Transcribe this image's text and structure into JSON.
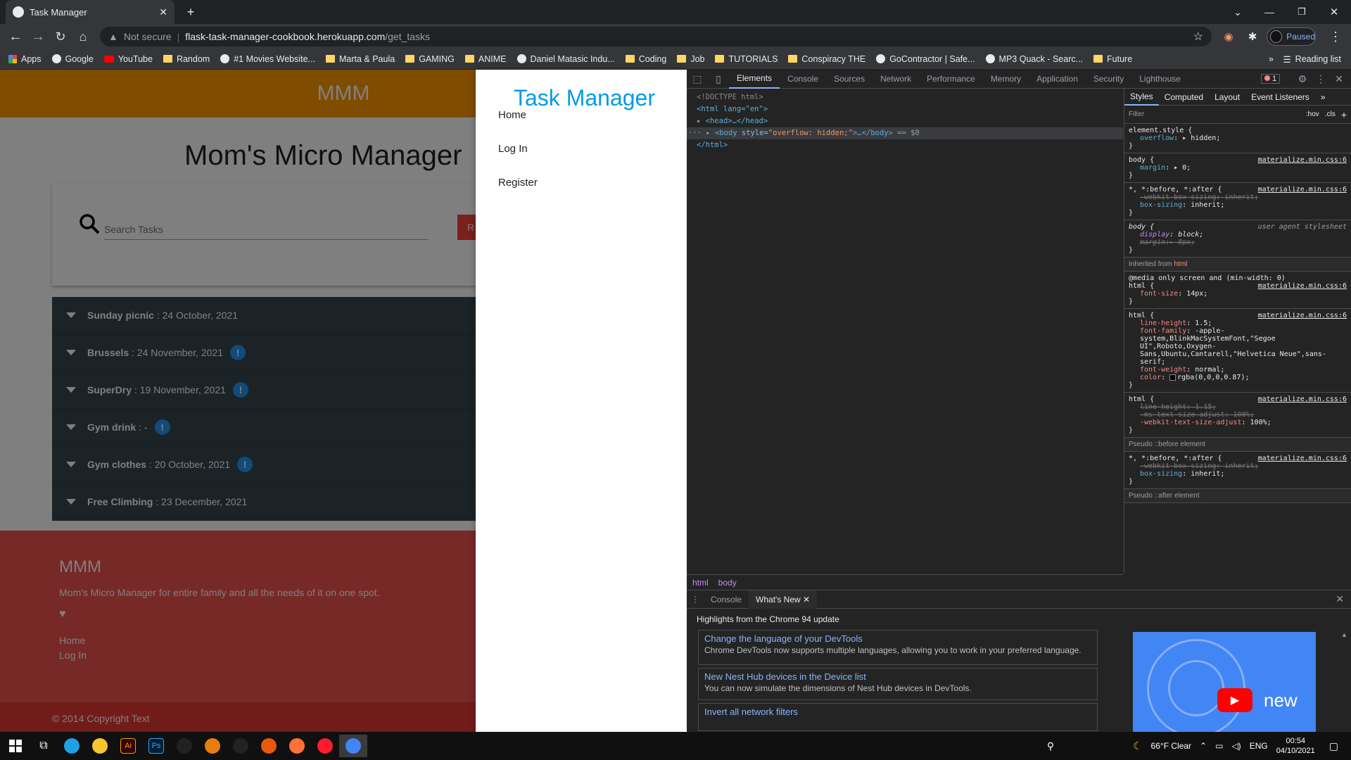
{
  "browser": {
    "tab_title": "Task Manager",
    "new_tab": "+",
    "url_warning": "Not secure",
    "url_sep": "|",
    "url_host": "flask-task-manager-cookbook.herokuapp.com",
    "url_path": "/get_tasks",
    "profile_label": "Paused",
    "bookmarks": [
      {
        "label": "Apps",
        "icon": "apps-icon"
      },
      {
        "label": "Google",
        "icon": "google-icon"
      },
      {
        "label": "YouTube",
        "icon": "youtube-icon"
      },
      {
        "label": "Random",
        "icon": "folder-icon"
      },
      {
        "label": "#1 Movies Website...",
        "icon": "loading-icon"
      },
      {
        "label": "Marta & Paula",
        "icon": "folder-icon"
      },
      {
        "label": "GAMING",
        "icon": "folder-icon"
      },
      {
        "label": "ANIME",
        "icon": "folder-icon"
      },
      {
        "label": "Daniel Matasic Indu...",
        "icon": "wix-icon"
      },
      {
        "label": "Coding",
        "icon": "folder-icon"
      },
      {
        "label": "Job",
        "icon": "folder-icon"
      },
      {
        "label": "TUTORIALS",
        "icon": "folder-icon"
      },
      {
        "label": "Conspiracy THE",
        "icon": "folder-icon"
      },
      {
        "label": "GoContractor | Safe...",
        "icon": "gocontractor-icon"
      },
      {
        "label": "MP3 Quack - Searc...",
        "icon": "mp3quack-icon"
      },
      {
        "label": "Future",
        "icon": "folder-icon"
      }
    ],
    "reading_list": "Reading list",
    "more_bookmarks": "»"
  },
  "page": {
    "brand": "MMM",
    "title": "Mom's Micro Manager",
    "search_placeholder": "Search Tasks",
    "reset_label": "R",
    "tasks": [
      {
        "name": "Sunday picnic",
        "date": "24 October, 2021",
        "urgent": false
      },
      {
        "name": "Brussels",
        "date": "24 November, 2021",
        "urgent": true
      },
      {
        "name": "SuperDry",
        "date": "19 November, 2021",
        "urgent": true
      },
      {
        "name": "Gym drink",
        "date": "-",
        "urgent": true
      },
      {
        "name": "Gym clothes",
        "date": "20 October, 2021",
        "urgent": true
      },
      {
        "name": "Free Climbing",
        "date": "23 December, 2021",
        "urgent": false
      }
    ],
    "footer": {
      "brand": "MMM",
      "description": "Mom's Micro Manager for entire family and all the needs of it on one spot.",
      "heart": "♥",
      "link1": "Home",
      "link2": "Log In",
      "copyright": "© 2014 Copyright Text"
    },
    "sidenav": {
      "brand": "Task Manager",
      "links": [
        "Home",
        "Log In",
        "Register"
      ]
    }
  },
  "devtools": {
    "tabs": [
      "Elements",
      "Console",
      "Sources",
      "Network",
      "Performance",
      "Memory",
      "Application",
      "Security",
      "Lighthouse"
    ],
    "more_tabs": "»",
    "error_count": "1",
    "dom": {
      "doctype": "<!DOCTYPE html>",
      "html_open": "<html lang=\"en\">",
      "head": "<head>…</head>",
      "body_tag": "<body ",
      "body_attr": "style=",
      "body_val": "\"overflow: hidden;\"",
      "body_close": ">…</body>",
      "body_eq": " == $0",
      "html_close": "</html>",
      "dots": "···"
    },
    "breadcrumbs": [
      "html",
      "body"
    ],
    "styles_tabs": [
      "Styles",
      "Computed",
      "Layout",
      "Event Listeners"
    ],
    "filter_placeholder": "Filter",
    "filter_hov": ":hov",
    "filter_cls": ".cls",
    "filter_plus": "+",
    "rules": {
      "element_style_sel": "element.style {",
      "element_style_prop": "overflow",
      "element_style_val": ": ▸ hidden;",
      "body1_sel": "body {",
      "body1_src": "materialize.min.css:6",
      "body1_prop": "margin",
      "body1_val": ": ▸ 0;",
      "star_sel": "*, *:before, *:after {",
      "star_src": "materialize.min.css:6",
      "star_p1": "-webkit-box-sizing",
      "star_v1": ": inherit;",
      "star_p2": "box-sizing",
      "star_v2": ": inherit;",
      "ua_sel": "body {",
      "ua_src": "user agent stylesheet",
      "ua_p1": "display",
      "ua_v1": ": block;",
      "ua_p2": "margin",
      "ua_v2": ":▸ 8px;",
      "inherited_label": "Inherited from",
      "inherited_tag": "html",
      "media_query": "@media only screen and (min-width: 0)",
      "html1_sel": "html {",
      "html1_src": "materialize.min.css:6",
      "html1_prop": "font-size",
      "html1_val": ": 14px;",
      "html2_sel": "html {",
      "html2_src": "materialize.min.css:6",
      "html2_p1": "line-height",
      "html2_v1": ": 1.5;",
      "html2_p2": "font-family",
      "html2_v2": ": -apple-system,BlinkMacSystemFont,\"Segoe UI\",Roboto,Oxygen-Sans,Ubuntu,Cantarell,\"Helvetica Neue\",sans-serif;",
      "html2_p3": "font-weight",
      "html2_v3": ": normal;",
      "html2_p4": "color",
      "html2_v4": "rgba(0,0,0,0.87);",
      "html3_sel": "html {",
      "html3_src": "materialize.min.css:6",
      "html3_p1": "line-height",
      "html3_v1": ": 1.15;",
      "html3_p2": "-ms-text-size-adjust",
      "html3_v2": ": 100%;",
      "html3_p3": "-webkit-text-size-adjust",
      "html3_v3": ": 100%;",
      "pseudo_before": "Pseudo ::before element",
      "pb_sel": "*, *:before, *:after {",
      "pb_src": "materialize.min.css:6",
      "pb_p1": "-webkit-box-sizing",
      "pb_v1": ": inherit;",
      "pb_p2": "box-sizing",
      "pb_v2": ": inherit;",
      "pseudo_after": "Pseudo ::after element",
      "close_brace": "}"
    },
    "drawer": {
      "tabs": [
        "Console",
        "What's New"
      ],
      "highlights": "Highlights from the Chrome 94 update",
      "news": [
        {
          "title": "Change the language of your DevTools",
          "desc": "Chrome DevTools now supports multiple languages, allowing you to work in your preferred language."
        },
        {
          "title": "New Nest Hub devices in the Device list",
          "desc": "You can now simulate the dimensions of Nest Hub devices in DevTools."
        },
        {
          "title": "Invert all network filters",
          "desc": ""
        }
      ],
      "video_text": "new"
    }
  },
  "taskbar": {
    "weather": "66°F  Clear",
    "lang": "ENG",
    "time": "00:54",
    "date": "04/10/2021",
    "apps": [
      "windows-start-icon",
      "task-view-icon",
      "edge-icon",
      "file-explorer-icon",
      "illustrator-icon",
      "photoshop-icon",
      "rider-icon",
      "blender-icon",
      "unity-icon",
      "app-icon",
      "firefox-icon",
      "opera-icon",
      "chrome-icon"
    ],
    "ai_label": "Ai",
    "ps_label": "Ps"
  },
  "colors": {
    "header": "#ff9800",
    "task_bg": "#37474f",
    "footer": "#ef5350",
    "sidenav_brand": "#039be5",
    "devtools_bg": "#242424"
  }
}
